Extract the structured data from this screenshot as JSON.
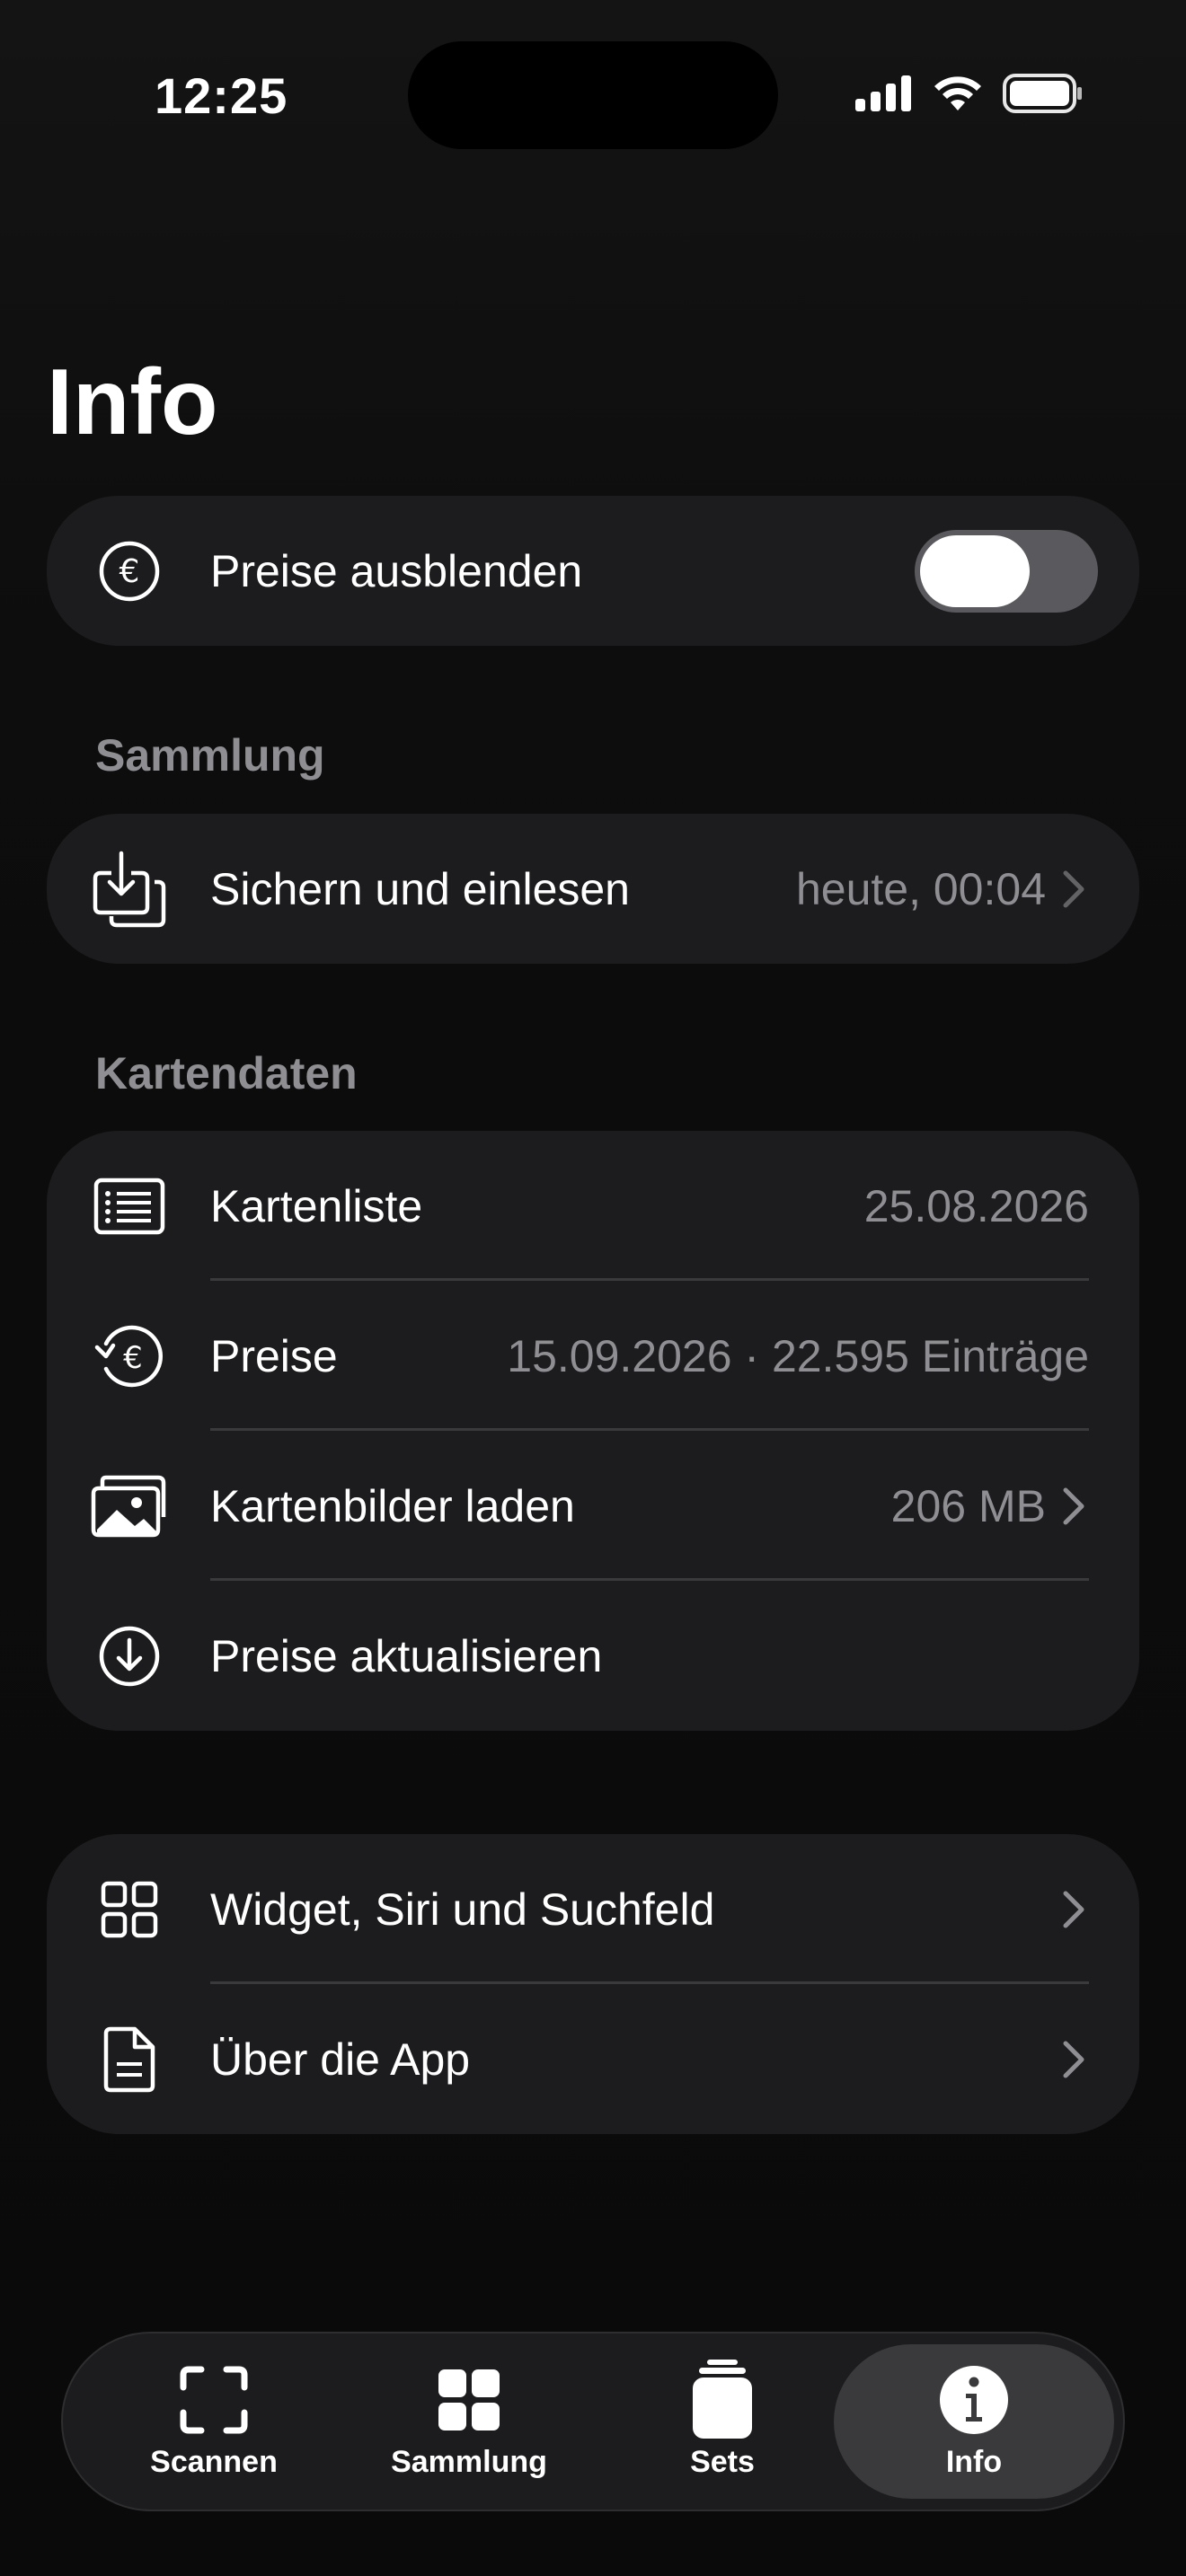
{
  "status_bar": {
    "time": "12:25"
  },
  "page_title": "Info",
  "hide_prices": {
    "label": "Preise ausblenden",
    "toggle_on": false,
    "icon": "euro-circle-icon"
  },
  "sections": {
    "collection": {
      "header": "Sammlung",
      "backup": {
        "label": "Sichern und einlesen",
        "value": "heute, 00:04",
        "icon": "backup-tray-icon"
      }
    },
    "card_data": {
      "header": "Kartendaten",
      "rows": [
        {
          "label": "Kartenliste",
          "value": "25.08.2026",
          "icon": "list-icon"
        },
        {
          "label": "Preise",
          "value": "15.09.2026 · 22.595 Einträge",
          "icon": "euro-refresh-icon"
        },
        {
          "label": "Kartenbilder laden",
          "value": "206 MB",
          "icon": "photos-icon"
        },
        {
          "label": "Preise aktualisieren",
          "value": "",
          "icon": "download-circle-icon"
        }
      ]
    },
    "more": {
      "rows": [
        {
          "label": "Widget, Siri und Suchfeld",
          "icon": "grid-icon"
        },
        {
          "label": "Über die App",
          "icon": "document-icon"
        }
      ]
    }
  },
  "tabbar": {
    "tabs": [
      {
        "label": "Scannen",
        "icon": "scan-frame-icon"
      },
      {
        "label": "Sammlung",
        "icon": "grid-tiles-icon"
      },
      {
        "label": "Sets",
        "icon": "card-stack-icon"
      },
      {
        "label": "Info",
        "icon": "info-circle-icon"
      }
    ],
    "active": "Info"
  },
  "colors": {
    "background": "#0b0b0b",
    "card": "#1c1c1e",
    "secondary_text": "#8e8e93",
    "divider": "#3a3a3c",
    "active_tab": "#3a3a3c"
  }
}
